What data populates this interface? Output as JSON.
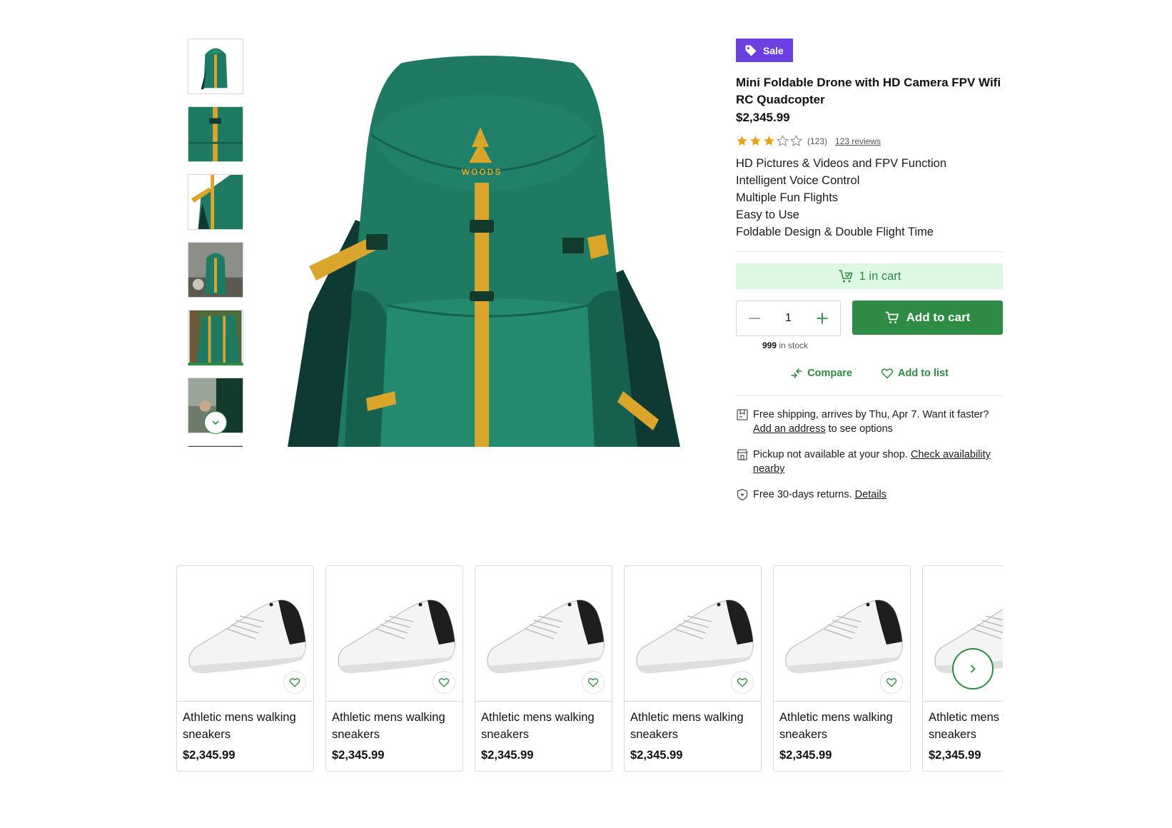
{
  "product": {
    "badge": "Sale",
    "title": "Mini Foldable Drone with HD Camera FPV Wifi RC Quadcopter",
    "price": "$2,345.99",
    "rating": 3,
    "rating_max": 5,
    "rating_count": "(123)",
    "reviews_link": "123 reviews",
    "features": [
      "HD Pictures & Videos and FPV Function",
      "Intelligent Voice Control",
      "Multiple Fun Flights",
      "Easy to Use",
      "Foldable Design & Double Flight Time"
    ],
    "main_image_logo": "WOODS"
  },
  "cart": {
    "in_cart_label": "1 in cart",
    "quantity": "1",
    "add_to_cart": "Add to cart",
    "stock_count": "999",
    "stock_suffix": "in stock",
    "compare": "Compare",
    "add_to_list": "Add to list"
  },
  "shipping": {
    "text": "Free shipping, arrives by Thu, Apr 7. Want it faster?",
    "address_link": "Add an address",
    "address_suffix": "to see options",
    "pickup_text": "Pickup not available at your shop.",
    "pickup_link": "Check availability nearby",
    "returns_text": "Free 30-days returns.",
    "returns_link": "Details"
  },
  "related": [
    {
      "name": "Athletic mens walking sneakers",
      "price": "$2,345.99"
    },
    {
      "name": "Athletic mens walking sneakers",
      "price": "$2,345.99"
    },
    {
      "name": "Athletic mens walking sneakers",
      "price": "$2,345.99"
    },
    {
      "name": "Athletic mens walking sneakers",
      "price": "$2,345.99"
    },
    {
      "name": "Athletic mens walking sneakers",
      "price": "$2,345.99"
    },
    {
      "name": "Athletic mens walking sneakers",
      "price": "$2,345.99"
    }
  ],
  "colors": {
    "accent": "#2e8b43",
    "sale": "#6b3fe0",
    "in_cart_bg": "#ddf7e3",
    "star": "#e8a317"
  },
  "icons": {
    "badge": "tag-icon",
    "in_cart": "cart-check-icon",
    "add_cart": "cart-icon",
    "compare": "compare-icon",
    "list": "heart-icon",
    "shipping": "box-icon",
    "pickup": "store-icon",
    "returns": "shield-icon",
    "carousel_next": "chevron-right-icon",
    "thumbs_down": "chevron-down-icon"
  }
}
